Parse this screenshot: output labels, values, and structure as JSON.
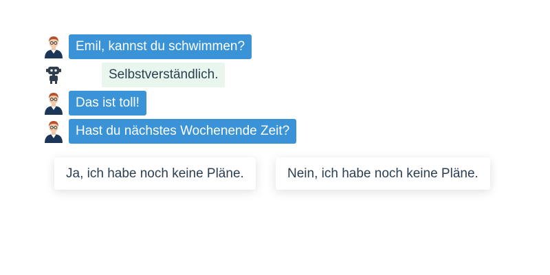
{
  "chat": {
    "messages": [
      {
        "sender": "user",
        "avatar_icon": "person-avatar-icon",
        "text": "Emil, kannst du schwimmen?"
      },
      {
        "sender": "bot",
        "avatar_icon": "robot-icon",
        "text": "Selbstverständlich."
      },
      {
        "sender": "user",
        "avatar_icon": "person-avatar-icon",
        "text": "Das ist toll!"
      },
      {
        "sender": "user",
        "avatar_icon": "person-avatar-icon",
        "text": "Hast du nächstes Wochenende Zeit?"
      }
    ],
    "choices": [
      {
        "label": "Ja, ich habe noch keine Pläne."
      },
      {
        "label": "Nein, ich habe noch keine Pläne."
      }
    ]
  },
  "colors": {
    "user_bubble": "#3993d6",
    "bot_bubble": "#e8f6ee",
    "text_dark": "#2b3e50"
  }
}
